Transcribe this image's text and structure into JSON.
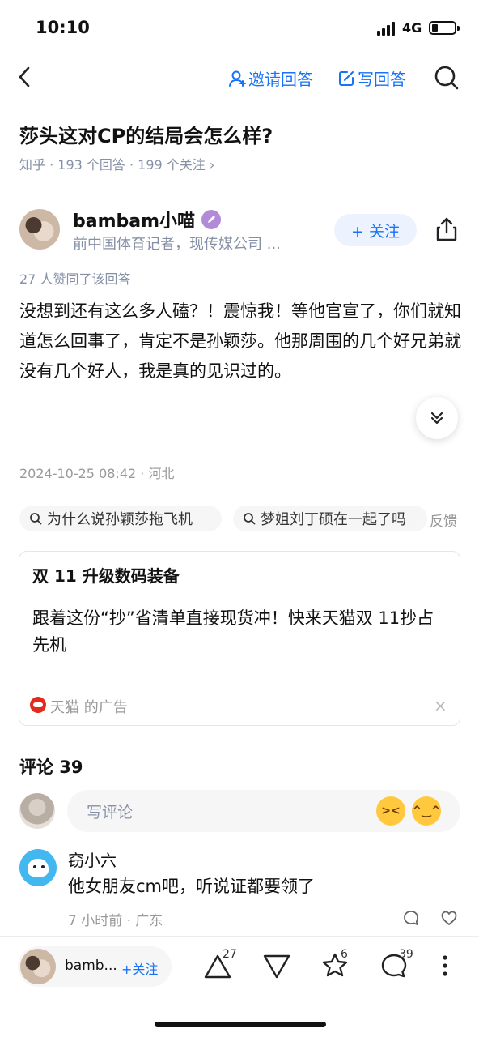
{
  "status_bar": {
    "time": "10:10",
    "network": "4G"
  },
  "nav": {
    "invite_label": "邀请回答",
    "write_label": "写回答"
  },
  "question": {
    "title": "莎头这对CP的结局会怎么样?",
    "meta": "知乎 · 193 个回答 · 199 个关注 ›"
  },
  "author": {
    "name": "bambam小喵",
    "bio": "前中国体育记者，现传媒公司 ...",
    "follow_label": "+ 关注"
  },
  "answer": {
    "likes_line": "27 人赞同了该回答",
    "text": "没想到还有这么多人磕？！震惊我！等他官宣了，你们就知道怎么回事了，肯定不是孙颖莎。他那周围的几个好兄弟就没有几个好人，我是真的见识过的。",
    "timestamp": "2024-10-25 08:42 · 河北"
  },
  "related_searches": [
    "为什么说孙颖莎拖飞机",
    "梦姐刘丁硕在一起了吗"
  ],
  "feedback_label": "反馈",
  "ad": {
    "title": "双 11 升级数码装备",
    "body": "跟着这份“抄”省清单直接现货冲！快来天猫双 11抄占先机",
    "source": "天猫 的广告",
    "close": "×"
  },
  "comments": {
    "header": "评论 39",
    "input_placeholder": "写评论",
    "items": [
      {
        "user": "窃小六",
        "text": "他女朋友cm吧，听说证都要领了",
        "meta": "7 小时前 · 广东"
      }
    ]
  },
  "bottom_bar": {
    "author_short": "bamb...",
    "follow_label": "+关注",
    "upvote_count": "27",
    "favorite_count": "6",
    "comment_count": "39"
  },
  "colors": {
    "accent": "#1772f6",
    "meta_gray": "#8590a6"
  }
}
